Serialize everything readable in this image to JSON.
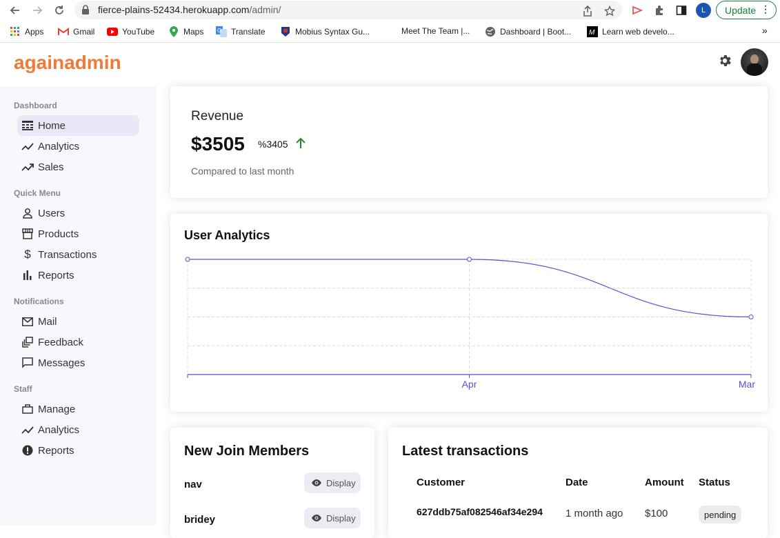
{
  "browser": {
    "url_host": "fierce-plains-52434.herokuapp.com",
    "url_path": "/admin/",
    "profile_initial": "L",
    "update_label": "Update",
    "bookmarks": [
      {
        "label": "Apps",
        "icon": "apps-grid-icon"
      },
      {
        "label": "Gmail",
        "icon": "gmail-icon"
      },
      {
        "label": "YouTube",
        "icon": "youtube-icon"
      },
      {
        "label": "Maps",
        "icon": "maps-icon"
      },
      {
        "label": "Translate",
        "icon": "translate-icon"
      },
      {
        "label": "Mobius Syntax Gu...",
        "icon": "mobius-icon"
      },
      {
        "label": "Meet The Team |...",
        "icon": ""
      },
      {
        "label": "Dashboard | Boot...",
        "icon": "globe-icon"
      },
      {
        "label": "Learn web develo...",
        "icon": "mdn-icon"
      }
    ],
    "more_bookmarks": "»"
  },
  "app": {
    "logo": "againadmin",
    "accent_color": "#f07a3a"
  },
  "sidebar": {
    "sections": [
      {
        "title": "Dashboard",
        "items": [
          "Home",
          "Analytics",
          "Sales"
        ]
      },
      {
        "title": "Quick Menu",
        "items": [
          "Users",
          "Products",
          "Transactions",
          "Reports"
        ]
      },
      {
        "title": "Notifications",
        "items": [
          "Mail",
          "Feedback",
          "Messages"
        ]
      },
      {
        "title": "Staff",
        "items": [
          "Manage",
          "Analytics",
          "Reports"
        ]
      }
    ]
  },
  "revenue": {
    "title": "Revenue",
    "amount": "$3505",
    "rate": "%3405",
    "trend": "up",
    "subtitle": "Compared to last month"
  },
  "analytics": {
    "title": "User Analytics",
    "line_color": "#5b4fcf"
  },
  "chart_data": {
    "type": "line",
    "title": "User Analytics",
    "categories": [
      "",
      "Apr",
      "Mar"
    ],
    "series": [
      {
        "values": [
          4,
          4,
          2
        ]
      }
    ],
    "ylim": [
      0,
      4
    ],
    "grid": true
  },
  "members": {
    "title": "New Join Members",
    "display_label": "Display",
    "items": [
      "nav",
      "bridey"
    ]
  },
  "transactions": {
    "title": "Latest transactions",
    "headers": [
      "Customer",
      "Date",
      "Amount",
      "Status"
    ],
    "rows": [
      {
        "customer": "627ddb75af082546af34e294",
        "date": "1 month ago",
        "amount": "$100",
        "status": "pending"
      }
    ]
  }
}
